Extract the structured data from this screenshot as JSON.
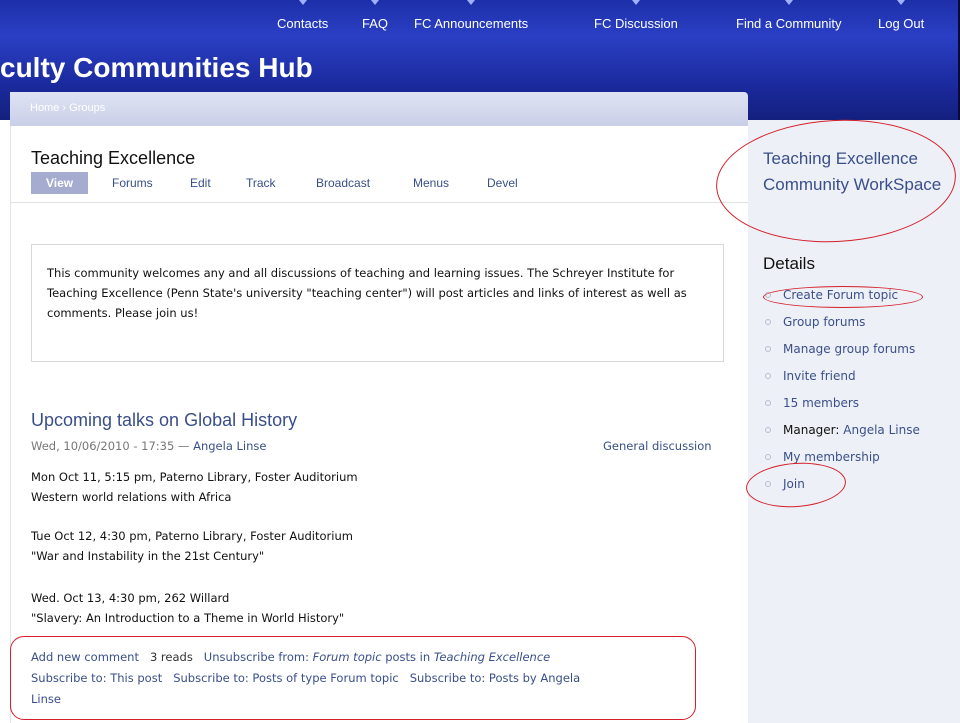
{
  "header": {
    "site_title": "culty Communities Hub",
    "nav": [
      {
        "label": "Contacts"
      },
      {
        "label": "FAQ"
      },
      {
        "label": "FC Announcements"
      },
      {
        "label": "FC Discussion"
      },
      {
        "label": "Find a Community"
      },
      {
        "label": "Log Out"
      }
    ]
  },
  "breadcrumb": {
    "home": "Home",
    "separator": "›",
    "current": "Groups"
  },
  "page": {
    "title": "Teaching Excellence",
    "tabs": [
      "View",
      "Forums",
      "Edit",
      "Track",
      "Broadcast",
      "Menus",
      "Devel"
    ],
    "intro": "This community welcomes any and all discussions of teaching and learning issues.  The Schreyer Institute for Teaching Excellence (Penn State's university \"teaching center\") will post articles and links of interest as well as comments.  Please join us!"
  },
  "post": {
    "title": "Upcoming talks on Global History",
    "date": "Wed, 10/06/2010 - 17:35 —",
    "author": "Angela Linse",
    "category": "General discussion",
    "events": [
      {
        "line1": "Mon Oct 11, 5:15 pm, Paterno Library, Foster Auditorium",
        "line2": "Western world relations with Africa"
      },
      {
        "line1": "Tue Oct 12, 4:30 pm, Paterno Library, Foster Auditorium",
        "line2": "\"War and Instability in the 21st Century\""
      },
      {
        "line1": "Wed. Oct 13, 4:30 pm, 262 Willard",
        "line2": "\"Slavery: An Introduction to a Theme in World History\""
      }
    ],
    "links": {
      "add_comment": "Add new comment",
      "reads": "3 reads",
      "unsubscribe_prefix": "Unsubscribe from:",
      "unsubscribe_type": "Forum topic",
      "unsubscribe_mid": "posts in",
      "unsubscribe_group": "Teaching Excellence",
      "subscribe_post": "Subscribe to: This post",
      "subscribe_type": "Subscribe to: Posts of type Forum topic",
      "subscribe_author_a": "Subscribe to: Posts by Angela",
      "subscribe_author_b": "Linse"
    }
  },
  "sidebar": {
    "workspace_title": "Teaching Excellence Community WorkSpace",
    "details_title": "Details",
    "items": [
      {
        "label": "Create Forum topic"
      },
      {
        "label": "Group forums"
      },
      {
        "label": "Manage group forums"
      },
      {
        "label": "Invite friend"
      },
      {
        "label": "15 members"
      },
      {
        "prefix": "Manager:",
        "label": "Angela Linse"
      },
      {
        "label": "My membership"
      },
      {
        "label": "Join"
      }
    ]
  },
  "colors": {
    "header_blue": "#1d2fa8",
    "link": "#3a4f8a",
    "annotation_red": "#d3202a",
    "active_tab": "#a6abd0",
    "sidebar_bg": "#eef0f7"
  }
}
